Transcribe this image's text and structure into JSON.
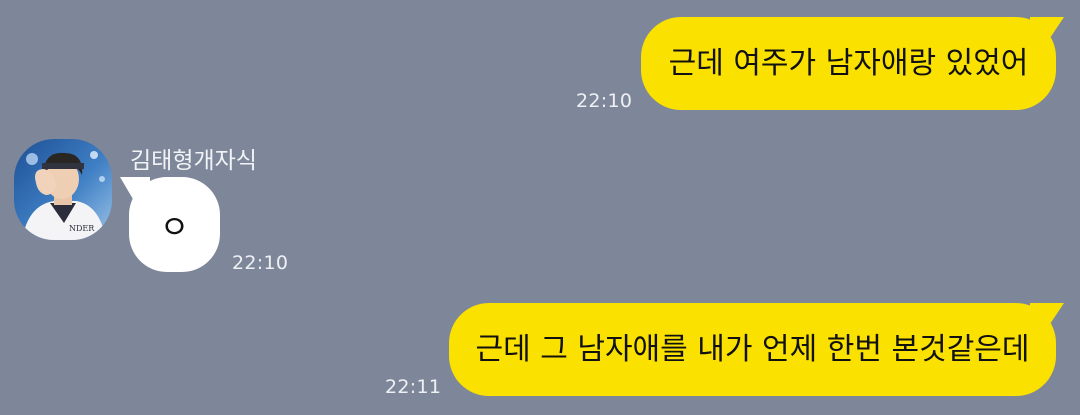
{
  "chat": {
    "messages": [
      {
        "direction": "outgoing",
        "text": "근데 여주가 남자애랑 있었어",
        "time": "22:10"
      },
      {
        "direction": "incoming",
        "sender": "김태형개자식",
        "text": "ㅇ",
        "time": "22:10"
      },
      {
        "direction": "outgoing",
        "text": "근데 그 남자애를 내가 언제 한번 본것같은데",
        "time": "22:11"
      }
    ]
  },
  "colors": {
    "background": "#7e8799",
    "outgoing_bubble": "#fae100",
    "incoming_bubble": "#ffffff",
    "timestamp_text": "#eef0f4"
  }
}
